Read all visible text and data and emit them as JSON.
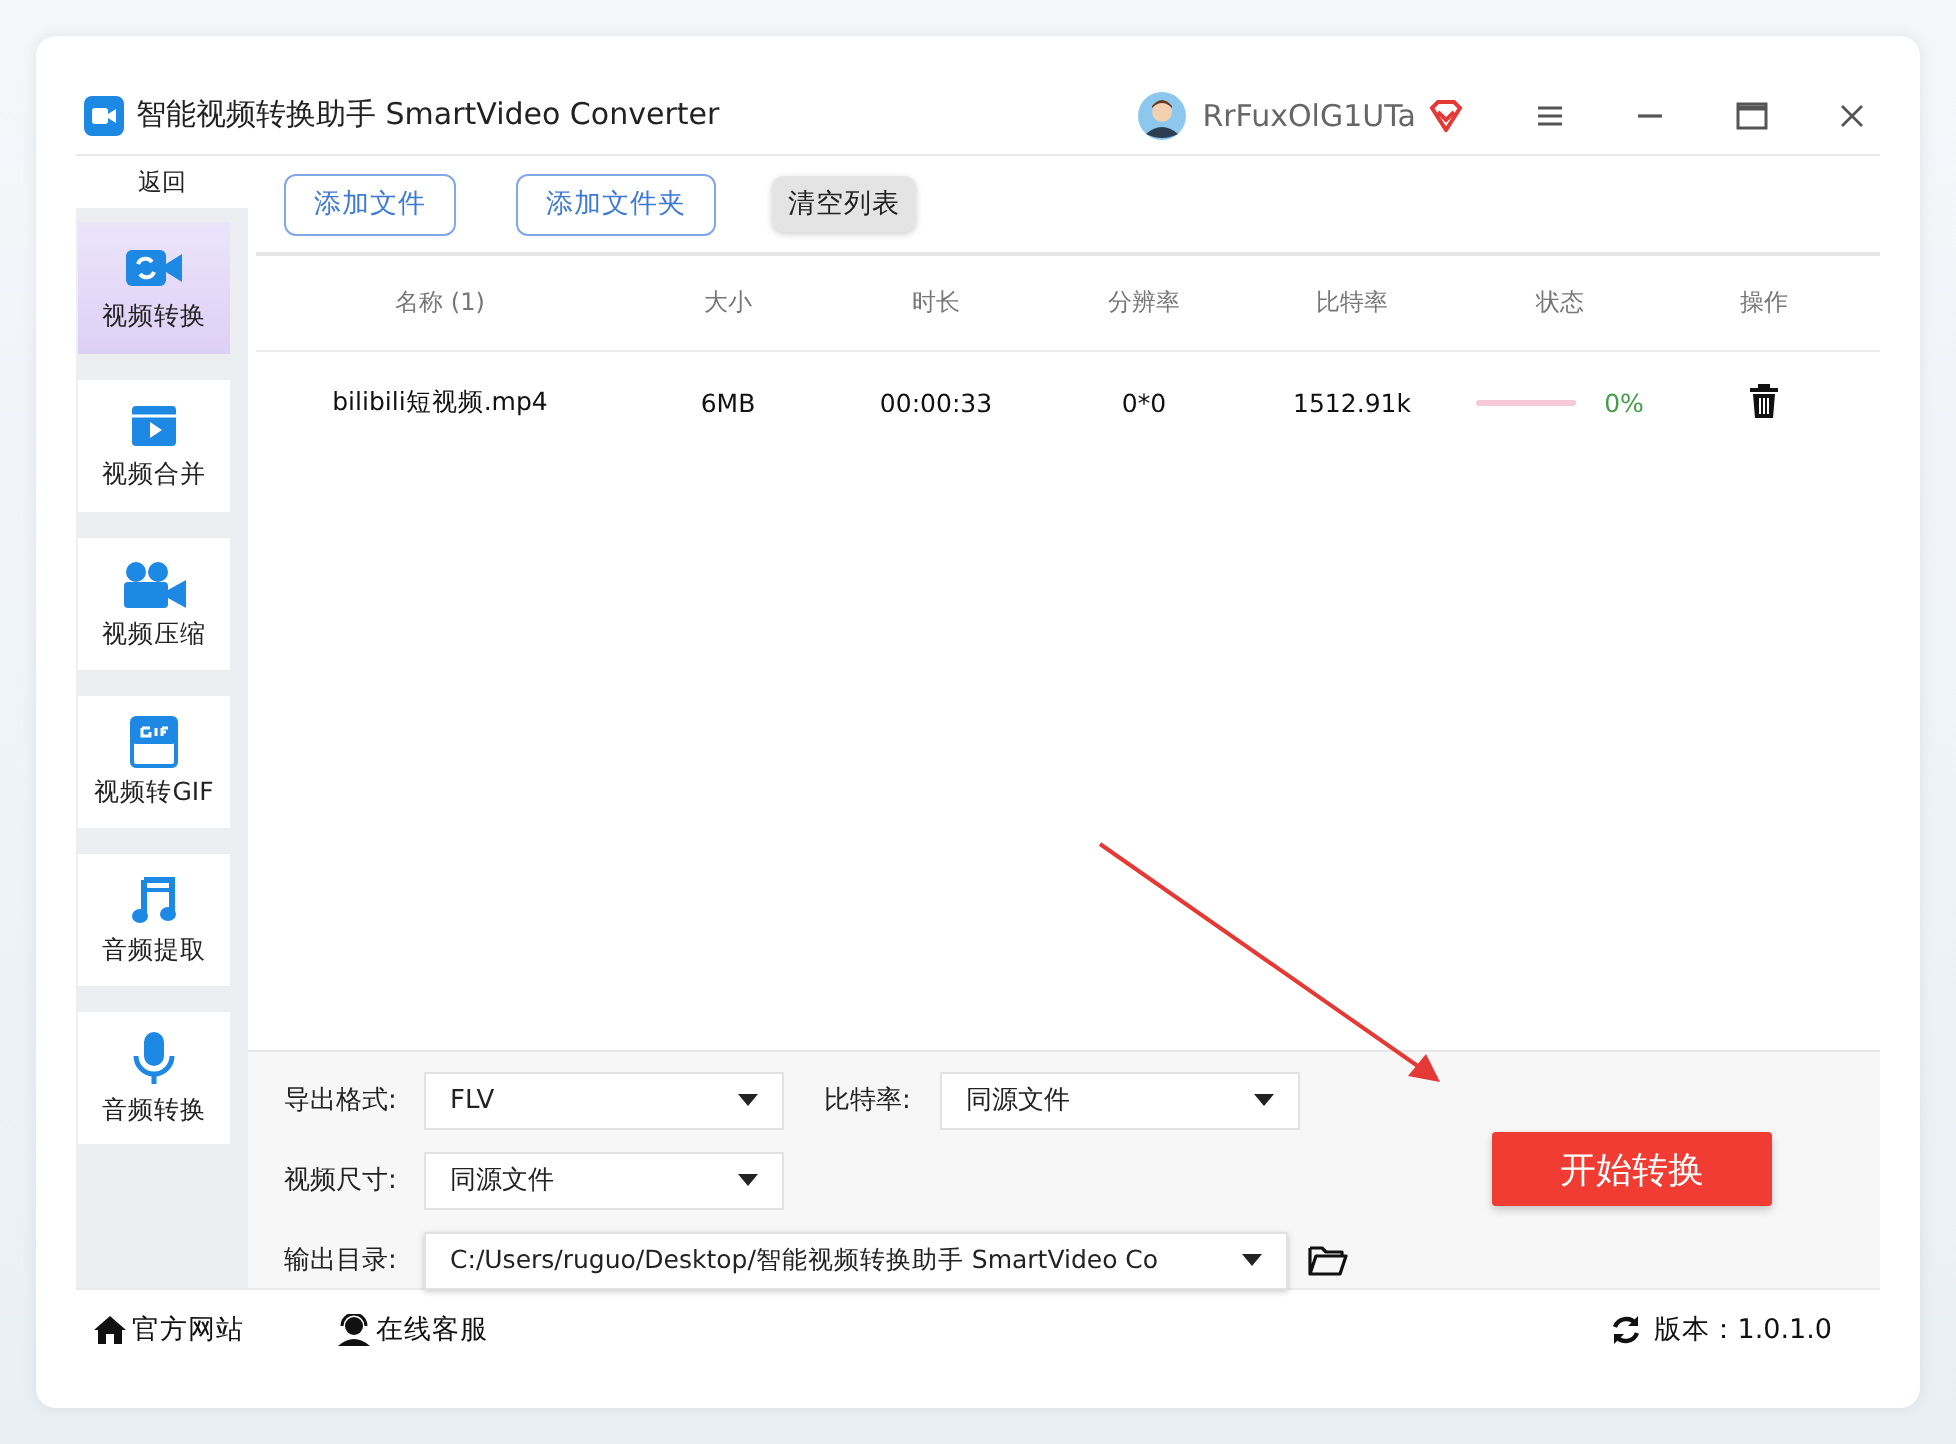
{
  "window": {
    "title": "智能视频转换助手 SmartVideo Converter"
  },
  "user": {
    "name": "RrFuxOlG1UTa"
  },
  "sidebar": {
    "back": "返回",
    "items": [
      {
        "label": "视频转换",
        "kind": "convert",
        "selected": true
      },
      {
        "label": "视频合并",
        "kind": "merge",
        "selected": false
      },
      {
        "label": "视频压缩",
        "kind": "compress",
        "selected": false
      },
      {
        "label": "视频转GIF",
        "kind": "gif",
        "selected": false
      },
      {
        "label": "音频提取",
        "kind": "music",
        "selected": false
      },
      {
        "label": "音频转换",
        "kind": "mic",
        "selected": false
      }
    ]
  },
  "toolbar": {
    "buttons": [
      {
        "label": "添加文件",
        "kind": "outline"
      },
      {
        "label": "添加文件夹",
        "kind": "outline"
      },
      {
        "label": "清空列表",
        "kind": "grey"
      }
    ]
  },
  "table": {
    "columns": [
      "名称 (1)",
      "大小",
      "时长",
      "分辨率",
      "比特率",
      "状态",
      "操作"
    ],
    "rows": [
      {
        "name": "bilibili短视频.mp4",
        "size": "6MB",
        "duration": "00:00:33",
        "resolution": "0*0",
        "bitrate": "1512.91k",
        "level": 0,
        "progress": "0%"
      }
    ]
  },
  "settings": {
    "format": {
      "label": "导出格式:",
      "value": "FLV"
    },
    "bitrate": {
      "label": "比特率:",
      "value": "同源文件"
    },
    "size": {
      "label": "视频尺寸:",
      "value": "同源文件"
    },
    "output": {
      "label": "输出目录:",
      "value": "C:/Users/ruguo/Desktop/智能视频转换助手 SmartVideo Co"
    },
    "start": "开始转换"
  },
  "footer": {
    "links": [
      {
        "label": "官方网站",
        "kind": "home"
      },
      {
        "label": "在线客服",
        "kind": "support"
      }
    ],
    "version": "版本：1.0.1.0"
  }
}
